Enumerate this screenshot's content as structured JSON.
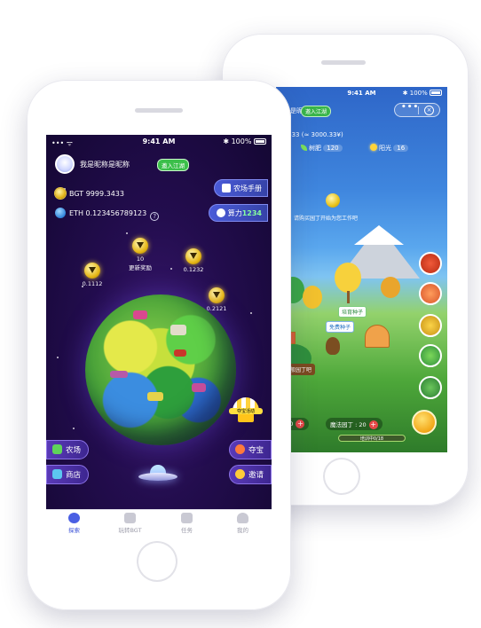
{
  "back_screen": {
    "status": {
      "time": "9:41 AM",
      "battery": "100%"
    },
    "nickname": "昵称是昵称",
    "badge": "邀入江湖",
    "capsule": {
      "more": "•••",
      "close": "×"
    },
    "balance_line": "9.3433 (≈ 3000.33¥)",
    "nutrient": {
      "label": "树肥",
      "value": "120"
    },
    "sunlight": {
      "label": "阳光",
      "value": "16"
    },
    "hint": "请购买园丁开始为您工作吧",
    "labels": {
      "seed": "培育种子",
      "fruit": "免费种子",
      "plaque": "第一般园丁吧"
    },
    "bottom": {
      "left_value": "200",
      "right_label": "魔法园丁 : 20"
    },
    "progress": {
      "text": "培训中0/18",
      "fraction": 0
    }
  },
  "front_screen": {
    "status": {
      "time": "9:41 AM",
      "battery": "100%",
      "signal": "••• ᯤ"
    },
    "nickname": "我是昵称是昵称",
    "badge": "邀入江湖",
    "tokens": [
      {
        "symbol": "BGT",
        "value": "9999.3433"
      },
      {
        "symbol": "ETH",
        "value": "0.123456789123"
      }
    ],
    "buttons": {
      "manual": "农场手册",
      "power_label": "算力",
      "power_value": "1234"
    },
    "rewards": [
      {
        "value": "10",
        "label": "更新奖励"
      },
      {
        "value": "0.1112",
        "label": ""
      },
      {
        "value": "0.1232",
        "label": ""
      },
      {
        "value": "0.2121",
        "label": ""
      }
    ],
    "treasure_label": "夺宝活动",
    "side_buttons": {
      "farm": "农场",
      "shop": "商店",
      "treasure": "夺宝",
      "invite": "邀请"
    },
    "tabs": [
      {
        "label": "探索",
        "icon": "planet-icon",
        "active": true
      },
      {
        "label": "玩转BGT",
        "icon": "coin-bag-icon",
        "active": false
      },
      {
        "label": "任务",
        "icon": "task-icon",
        "active": false
      },
      {
        "label": "我的",
        "icon": "profile-icon",
        "active": false
      }
    ]
  }
}
